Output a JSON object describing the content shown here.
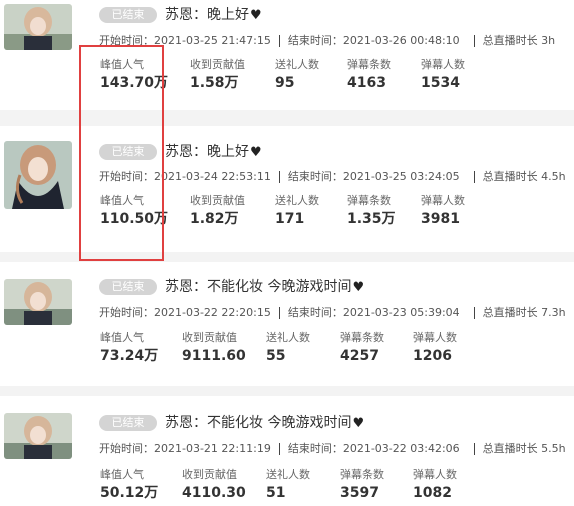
{
  "status_badge": "已结束",
  "labels": {
    "start": "开始时间：",
    "end": "结束时间：",
    "duration": "总直播时长",
    "peak": "峰值人气",
    "contribution": "收到贡献值",
    "gifters": "送礼人数",
    "danmaku_count": "弹幕条数",
    "danmaku_users": "弹幕人数"
  },
  "streams": [
    {
      "title": "苏恩：晚上好",
      "start": "2021-03-25 21:47:15",
      "end": "2021-03-26 00:48:10",
      "duration": "3h",
      "peak": "143.70万",
      "contribution": "1.58万",
      "gifters": "95",
      "danmaku_count": "4163",
      "danmaku_users": "1534"
    },
    {
      "title": "苏恩：晚上好",
      "start": "2021-03-24 22:53:11",
      "end": "2021-03-25 03:24:05",
      "duration": "4.5h",
      "peak": "110.50万",
      "contribution": "1.82万",
      "gifters": "171",
      "danmaku_count": "1.35万",
      "danmaku_users": "3981"
    },
    {
      "title": "苏恩：不能化妆 今晚游戏时间",
      "start": "2021-03-22 22:20:15",
      "end": "2021-03-23 05:39:04",
      "duration": "7.3h",
      "peak": "73.24万",
      "contribution": "9111.60",
      "gifters": "55",
      "danmaku_count": "4257",
      "danmaku_users": "1206"
    },
    {
      "title": "苏恩：不能化妆 今晚游戏时间",
      "start": "2021-03-21 22:11:19",
      "end": "2021-03-22 03:42:06",
      "duration": "5.5h",
      "peak": "50.12万",
      "contribution": "4110.30",
      "gifters": "51",
      "danmaku_count": "3597",
      "danmaku_users": "1082"
    }
  ],
  "icons": {
    "heart": "heart-icon"
  },
  "colors": {
    "highlight_box": "#e04040",
    "badge": "#d4d4d4"
  }
}
